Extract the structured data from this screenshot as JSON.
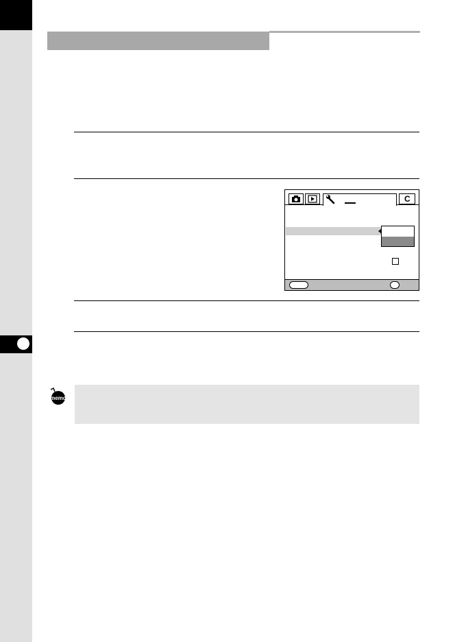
{
  "page": {
    "chapter_number": "",
    "heading": "",
    "memo_label": "memo"
  },
  "screen": {
    "custom_tab_label": "C"
  }
}
